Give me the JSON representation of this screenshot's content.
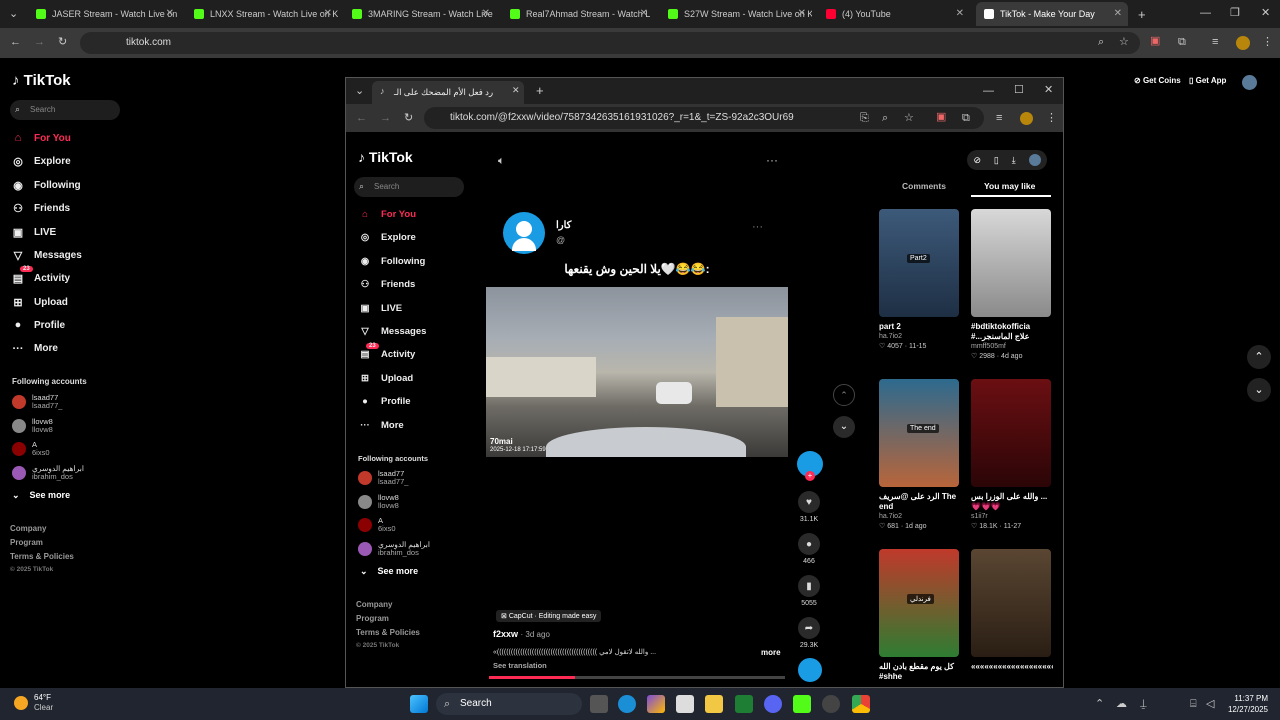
{
  "browser": {
    "tabs": [
      {
        "label": "JASER Stream - Watch Live on K",
        "color": "#53fc18"
      },
      {
        "label": "LNXX Stream - Watch Live on K",
        "color": "#53fc18"
      },
      {
        "label": "3MARING Stream - Watch Live",
        "color": "#53fc18"
      },
      {
        "label": "Real7Ahmad Stream - Watch L",
        "color": "#53fc18"
      },
      {
        "label": "S27W Stream - Watch Live on K",
        "color": "#53fc18"
      },
      {
        "label": "(4) YouTube",
        "color": "#ff0033"
      },
      {
        "label": "TikTok - Make Your Day",
        "color": "#ffffff"
      }
    ],
    "url": "tiktok.com"
  },
  "page": {
    "logo": "TikTok",
    "search_placeholder": "Search",
    "get_coins": "Get Coins",
    "get_app": "Get App",
    "nav": [
      "For You",
      "Explore",
      "Following",
      "Friends",
      "LIVE",
      "Messages",
      "Activity",
      "Upload",
      "Profile",
      "More"
    ],
    "activity_badge": "23",
    "following_title": "Following accounts",
    "accounts": [
      {
        "name": "lsaad77",
        "handle": "lsaad77_"
      },
      {
        "name": "llovw8",
        "handle": "llovw8"
      },
      {
        "name": "A",
        "handle": "6ixs0"
      },
      {
        "name": "ابراهيم الدوسري",
        "handle": "ibrahim_dos"
      }
    ],
    "see_more": "See more",
    "footer": [
      "Company",
      "Program",
      "Terms & Policies",
      "© 2025 TikTok"
    ]
  },
  "inner": {
    "tab_title": "رد فعل الأم المضحك على الـ",
    "url": "tiktok.com/@f2xxw/video/7587342635161931026?_r=1&_t=ZS-92a2c3OUr69",
    "logo": "TikTok",
    "search_placeholder": "Search",
    "nav": [
      "For You",
      "Explore",
      "Following",
      "Friends",
      "LIVE",
      "Messages",
      "Activity",
      "Upload",
      "Profile",
      "More"
    ],
    "activity_badge": "23",
    "following_title": "Following accounts",
    "accounts": [
      {
        "name": "lsaad77",
        "handle": "lsaad77_"
      },
      {
        "name": "llovw8",
        "handle": "llovw8"
      },
      {
        "name": "A",
        "handle": "6ixs0"
      },
      {
        "name": "ابراهيم الدوسري",
        "handle": "ibrahim_dos"
      }
    ],
    "see_more": "See more",
    "footer": [
      "Company",
      "Program",
      "Terms & Policies",
      "© 2025 TikTok"
    ],
    "post": {
      "user": "كارا",
      "handle": "@",
      "caption": "يلا الحين وش يقنعها🤍😂😂:",
      "stamp_brand": "70mai",
      "stamp_date": "2025-12-18    17:17:59",
      "capcut": "CapCut · Editing made easy",
      "author": "f2xxw",
      "time": "· 3d ago",
      "desc": "«((((((((((((((((((((((((((((((((((((((((((( والله لاتقول لامي ...",
      "more": "more",
      "see_translation": "See translation"
    },
    "actions": {
      "likes": "31.1K",
      "comments": "466",
      "saves": "5055",
      "shares": "29.3K"
    },
    "right_tabs": [
      "Comments",
      "You may like"
    ],
    "videos": [
      {
        "title": "part 2",
        "author": "ha.7io2",
        "likes": "4057",
        "date": "11-15",
        "tag": "Part2"
      },
      {
        "title": "#bdtiktokofficia #...علاج الماسنجر",
        "author": "mmff505mf",
        "likes": "2988",
        "date": "4d ago",
        "tag": ""
      },
      {
        "title": "الرد على @سريف The end",
        "author": "ha.7io2",
        "likes": "681",
        "date": "1d ago",
        "tag": "The end"
      },
      {
        "title": "والله على الوزرا بس ...💗💗💗",
        "author": "s1ii7r",
        "likes": "18.1K",
        "date": "11-27",
        "tag": ""
      },
      {
        "title": "كل يوم مقطع بادن الله #shhe",
        "author": "",
        "likes": "",
        "date": "",
        "tag": "فرندلي"
      },
      {
        "title": "«««««««««««««««««««««",
        "author": "",
        "likes": "",
        "date": "",
        "tag": ""
      }
    ]
  },
  "taskbar": {
    "weather_temp": "64°F",
    "weather_desc": "Clear",
    "search": "Search",
    "time": "11:37 PM",
    "date": "12/27/2025"
  }
}
